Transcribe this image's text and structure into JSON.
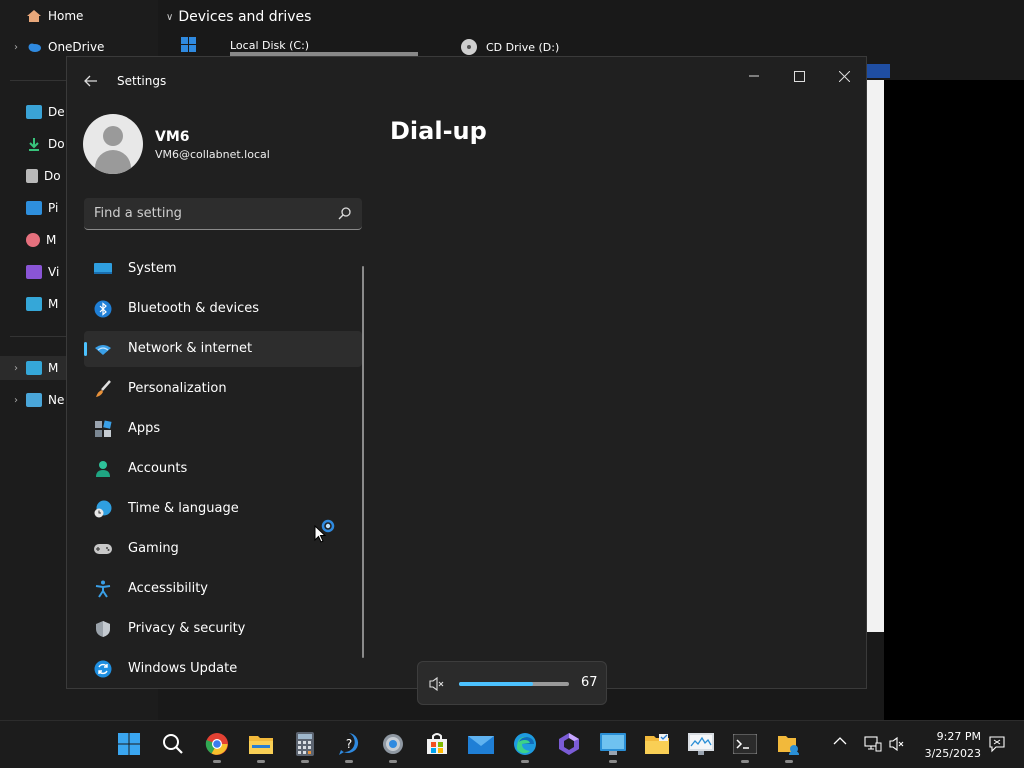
{
  "explorer": {
    "nav": {
      "home": "Home",
      "onedrive": "OneDrive",
      "items": [
        "De",
        "Do",
        "Do",
        "Pi",
        "M",
        "Vi",
        "M"
      ],
      "bottom": [
        "M",
        "Ne"
      ]
    },
    "section_header": "Devices and drives",
    "drives": [
      "Local Disk (C:)",
      "CD Drive (D:)"
    ]
  },
  "settings": {
    "app_title": "Settings",
    "user": {
      "name": "VM6",
      "email": "VM6@collabnet.local"
    },
    "search": {
      "placeholder": "Find a setting"
    },
    "nav_items": [
      {
        "label": "System",
        "icon": "monitor-icon"
      },
      {
        "label": "Bluetooth & devices",
        "icon": "bluetooth-icon"
      },
      {
        "label": "Network & internet",
        "icon": "wifi-icon",
        "selected": true
      },
      {
        "label": "Personalization",
        "icon": "brush-icon"
      },
      {
        "label": "Apps",
        "icon": "apps-icon"
      },
      {
        "label": "Accounts",
        "icon": "person-icon"
      },
      {
        "label": "Time & language",
        "icon": "globe-clock-icon"
      },
      {
        "label": "Gaming",
        "icon": "gamepad-icon"
      },
      {
        "label": "Accessibility",
        "icon": "accessibility-icon"
      },
      {
        "label": "Privacy & security",
        "icon": "shield-icon"
      },
      {
        "label": "Windows Update",
        "icon": "update-icon"
      }
    ],
    "page_title": "Dial-up"
  },
  "volume": {
    "level": 67,
    "label": "67"
  },
  "taskbar": {
    "apps": [
      "start-icon",
      "search-icon",
      "chrome-icon",
      "file-explorer-icon",
      "calculator-icon",
      "help-icon",
      "settings-icon",
      "store-icon",
      "mail-icon",
      "edge-icon",
      "copilot-icon",
      "remote-desktop-icon",
      "folder-icon",
      "resource-monitor-icon",
      "terminal-icon",
      "share-icon"
    ],
    "clock": {
      "time": "9:27 PM",
      "date": "3/25/2023"
    }
  },
  "colors": {
    "accent": "#4cc2ff",
    "window_bg": "#202020",
    "selected_bg": "#2d2d2d"
  }
}
